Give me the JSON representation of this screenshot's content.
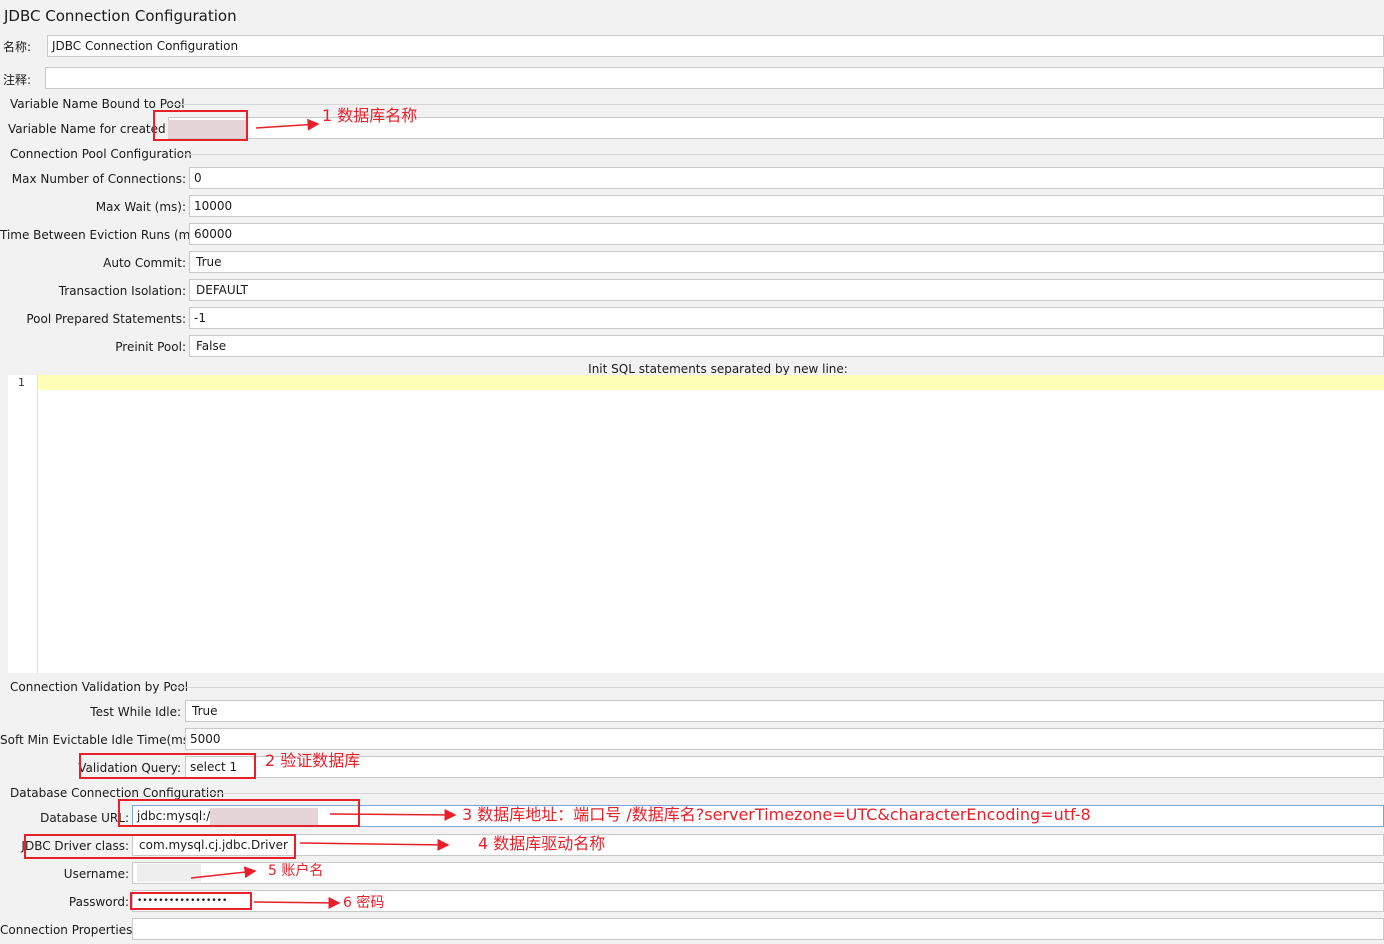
{
  "panel": {
    "title": "JDBC Connection Configuration"
  },
  "name_row": {
    "label": "名称:",
    "value": "JDBC Connection Configuration"
  },
  "comment_row": {
    "label": "注释:",
    "value": ""
  },
  "variable_section": {
    "title": "Variable Name Bound to Pool",
    "field": {
      "label": "Variable Name for created poo",
      "value": ""
    }
  },
  "pool_section": {
    "title": "Connection Pool Configuration",
    "fields": [
      {
        "label": "Max Number of Connections:",
        "value": "0"
      },
      {
        "label": "Max Wait (ms):",
        "value": "10000"
      },
      {
        "label": "Time Between Eviction Runs (ms):",
        "value": "60000"
      },
      {
        "label": "Auto Commit:",
        "value": "True"
      },
      {
        "label": "Transaction Isolation:",
        "value": "DEFAULT"
      },
      {
        "label": "Pool Prepared Statements:",
        "value": "-1"
      },
      {
        "label": "Preinit Pool:",
        "value": "False"
      }
    ],
    "init_sql": {
      "label": "Init SQL statements separated by new line:",
      "line_number": "1"
    }
  },
  "validation_section": {
    "title": "Connection Validation by Pool",
    "fields": [
      {
        "label": "Test While Idle:",
        "value": "True"
      },
      {
        "label": "Soft Min Evictable Idle Time(ms):",
        "value": "5000"
      },
      {
        "label": "Validation Query:",
        "value": "select 1"
      }
    ]
  },
  "database_section": {
    "title": "Database Connection Configuration",
    "fields": [
      {
        "label": "Database URL:",
        "value": "jdbc:mysql://"
      },
      {
        "label": "JDBC Driver class:",
        "value": "com.mysql.cj.jdbc.Driver"
      },
      {
        "label": "Username:",
        "value": ""
      },
      {
        "label": "Password:",
        "value": "•••••••••••••••••"
      },
      {
        "label": "Connection Properties:",
        "value": ""
      }
    ]
  },
  "annotations": {
    "a1": "1 数据库名称",
    "a2": "2 验证数据库",
    "a3": "3 数据库地址：端口号 /数据库名?serverTimezone=UTC&characterEncoding=utf-8",
    "a4": "4 数据库驱动名称",
    "a5": "5 账户名",
    "a6": "6 密码"
  },
  "colors": {
    "annotation_red": "#e8202a",
    "highlight_line": "#ffffb8",
    "url_field_border": "#7aa7d8"
  }
}
